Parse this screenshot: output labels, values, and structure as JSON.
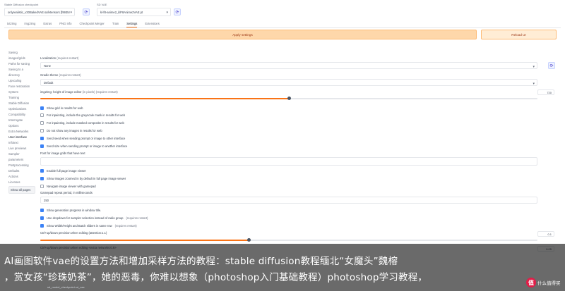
{
  "header": {
    "checkpoint_label": "Stable Diffusion checkpoint",
    "checkpoint_value": "onlyrealistic_v30BakedVAE.safetensors [f9935446f]",
    "vae_label": "SD VAE",
    "vae_value": "kl-f8-anime2_klF8Anime2VAE.pt",
    "refresh_icon": "refresh-icon"
  },
  "tabs": [
    "txt2img",
    "img2img",
    "Extras",
    "PNG Info",
    "Checkpoint Merger",
    "Train",
    "Settings",
    "Extensions"
  ],
  "active_tab": "Settings",
  "buttons": {
    "apply": "Apply settings",
    "reload": "Reload UI"
  },
  "sidebar": [
    "Saving",
    "images/grids",
    "Paths for saving",
    "Saving to a",
    "directory",
    "Upscaling",
    "Face restoration",
    "System",
    "Training",
    "Stable Diffusion",
    "Optimizations",
    "Compatibility",
    "Interrogate",
    "Options",
    "Extra Networks",
    "User interface",
    "Infotext",
    "Live previews",
    "Sampler",
    "parameters",
    "Postprocessing",
    "Defaults",
    "Actions",
    "Licenses",
    "Show all pages"
  ],
  "settings": {
    "localization_label": "Localization",
    "localization_req": "(requires restart)",
    "localization_value": "None",
    "gradio_theme_label": "Gradio theme",
    "gradio_theme_req": "(requires restart)",
    "gradio_theme_value": "Default",
    "img2img_height_label": "img2img: height of image editor",
    "img2img_height_req": "(in pixels) (requires restart)",
    "img2img_height_value": "720",
    "img2img_height_fraction": 0.5,
    "cb_show_grid": "Show grid in results for web",
    "cb_grayscale": "For inpainting, include the greyscale mask in results for web",
    "cb_composite": "For inpainting, include masked composite in results for web",
    "cb_no_images": "Do not show any images in results for web",
    "cb_send_seed": "Send seed when sending prompt or image to other interface",
    "cb_send_size": "Send size when sending prompt or image to another interface",
    "font_label": "Font for image grids that have text",
    "cb_fullpage": "Enable full page image viewer",
    "cb_zoomed": "Show images zoomed in by default in full page image viewer",
    "cb_gamepad": "Navigate image viewer with gamepad",
    "gamepad_label": "Gamepad repeat period, in milliseconds",
    "gamepad_value": "250",
    "cb_progress_title": "Show generation progress in window title.",
    "cb_dropdowns": "Use dropdown for sampler selection instead of radio group",
    "cb_dropdowns_req": "(requires restart)",
    "cb_same_row": "Show Width/Height and Batch sliders in same row",
    "cb_same_row_req": "(requires restart)",
    "ctrl_up_label": "Ctrl+up/down precision when editing (attention:1.1)",
    "ctrl_up_value": "0.1",
    "ctrl_up_fraction": 0.42,
    "ctrl_up2_label": "Ctrl+up/down precision when editing <extra networks:0.9>",
    "ctrl_up2_value": "0.05"
  },
  "caption": {
    "line1": "AI画图软件vae的设置方法和增加采样方法的教程：stable diffusion教程缅北“女魔头”魏榕",
    "line2": "，赏女孩“珍珠奶茶”，她的恶毒，你难以想象（photoshop入门基础教程）photoshop学习教程，"
  },
  "bottom_ghost": "sd_model_checkpoint   sd_vae",
  "watermark": {
    "badge": "值",
    "text": "什么值得买"
  }
}
